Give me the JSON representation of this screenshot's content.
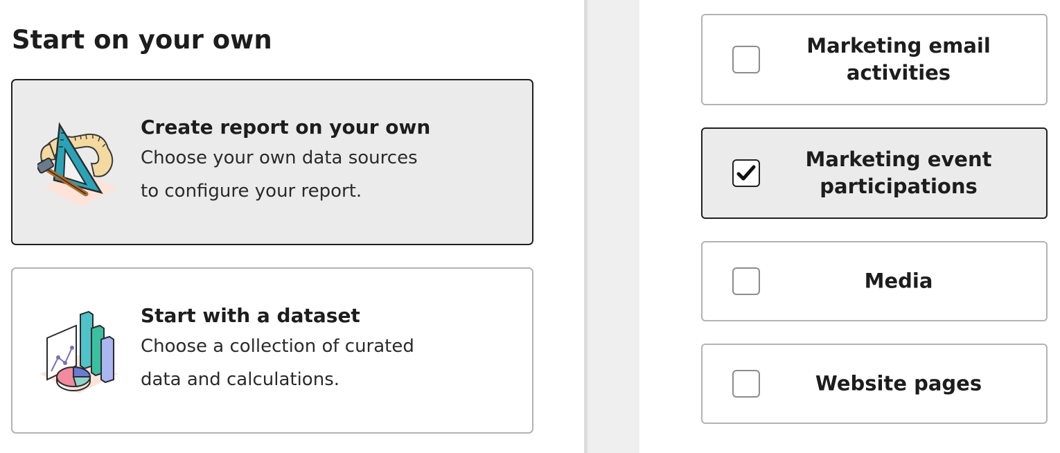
{
  "left": {
    "title": "Start on your own",
    "cards": [
      {
        "title": "Create report on your own",
        "desc_line1": "Choose your own data sources",
        "desc_line2": "to configure your report.",
        "icon": "ruler-hammer-icon",
        "selected": true
      },
      {
        "title": "Start with a dataset",
        "desc_line1": "Choose a collection of curated",
        "desc_line2": "data and calculations.",
        "icon": "dataset-charts-icon",
        "selected": false
      }
    ]
  },
  "right": {
    "sources": [
      {
        "label_line1": "Marketing email",
        "label_line2": "activities",
        "checked": false
      },
      {
        "label_line1": "Marketing event",
        "label_line2": "participations",
        "checked": true
      },
      {
        "label_line1": "Media",
        "checked": false
      },
      {
        "label_line1": "Website pages",
        "checked": false
      }
    ]
  },
  "colors": {
    "selected_bg": "#ebebeb",
    "selected_border": "#1f1f1f",
    "default_border": "#b3b3b3",
    "divider": "#efefef"
  }
}
